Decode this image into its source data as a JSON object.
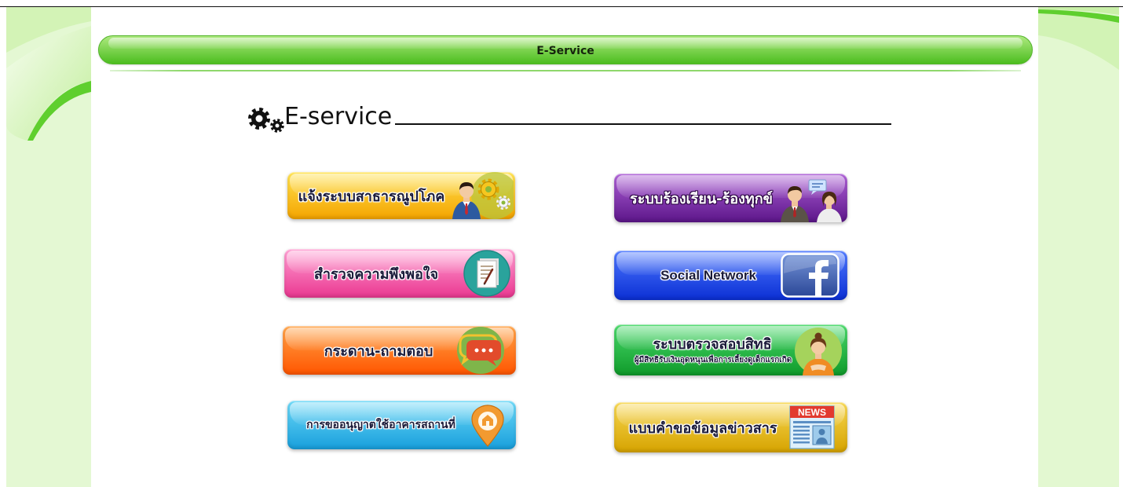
{
  "header": {
    "bar_title": "E-Service",
    "color_top": "#ade97f",
    "color_bottom": "#4cbd1f"
  },
  "section": {
    "title": "E-service",
    "icon": "gears-icon"
  },
  "services": [
    {
      "label": "แจ้งระบบสาธารณูปโภค",
      "icon": "person-gears-icon",
      "color_top": "#ffe24f",
      "color_bottom": "#f4a400"
    },
    {
      "label": "ระบบร้องเรียน-ร้องทุกข์",
      "icon": "people-talk-icon",
      "color_top": "#ad5fd6",
      "color_bottom": "#5c1689"
    },
    {
      "label": "สำรวจความพึงพอใจ",
      "icon": "document-icon",
      "color_top": "#ff9fd3",
      "color_bottom": "#ea3790"
    },
    {
      "label": "Social Network",
      "icon": "facebook-icon",
      "color_top": "#4d78ff",
      "color_bottom": "#0b2fd4"
    },
    {
      "label": "กระดาน-ถามตอบ",
      "icon": "chat-bubble-icon",
      "color_top": "#ffa347",
      "color_bottom": "#ff5500"
    },
    {
      "label": "ระบบตรวจสอบสิทธิ",
      "sublabel": "ผู้มีสิทธิรับเงินอุดหนุนเพื่อการเลี้ยงดูเด็กแรกเกิด",
      "icon": "mother-icon",
      "color_top": "#49d96a",
      "color_bottom": "#0f9a2a"
    },
    {
      "label": "การขออนุญาตใช้อาคารสถานที่",
      "icon": "location-pin-icon",
      "color_top": "#6cd8f7",
      "color_bottom": "#189fdc"
    },
    {
      "label": "แบบคำขอข้อมูลข่าวสาร",
      "icon": "news-icon",
      "icon_text": "NEWS",
      "color_top": "#f7d751",
      "color_bottom": "#d6a300"
    }
  ]
}
